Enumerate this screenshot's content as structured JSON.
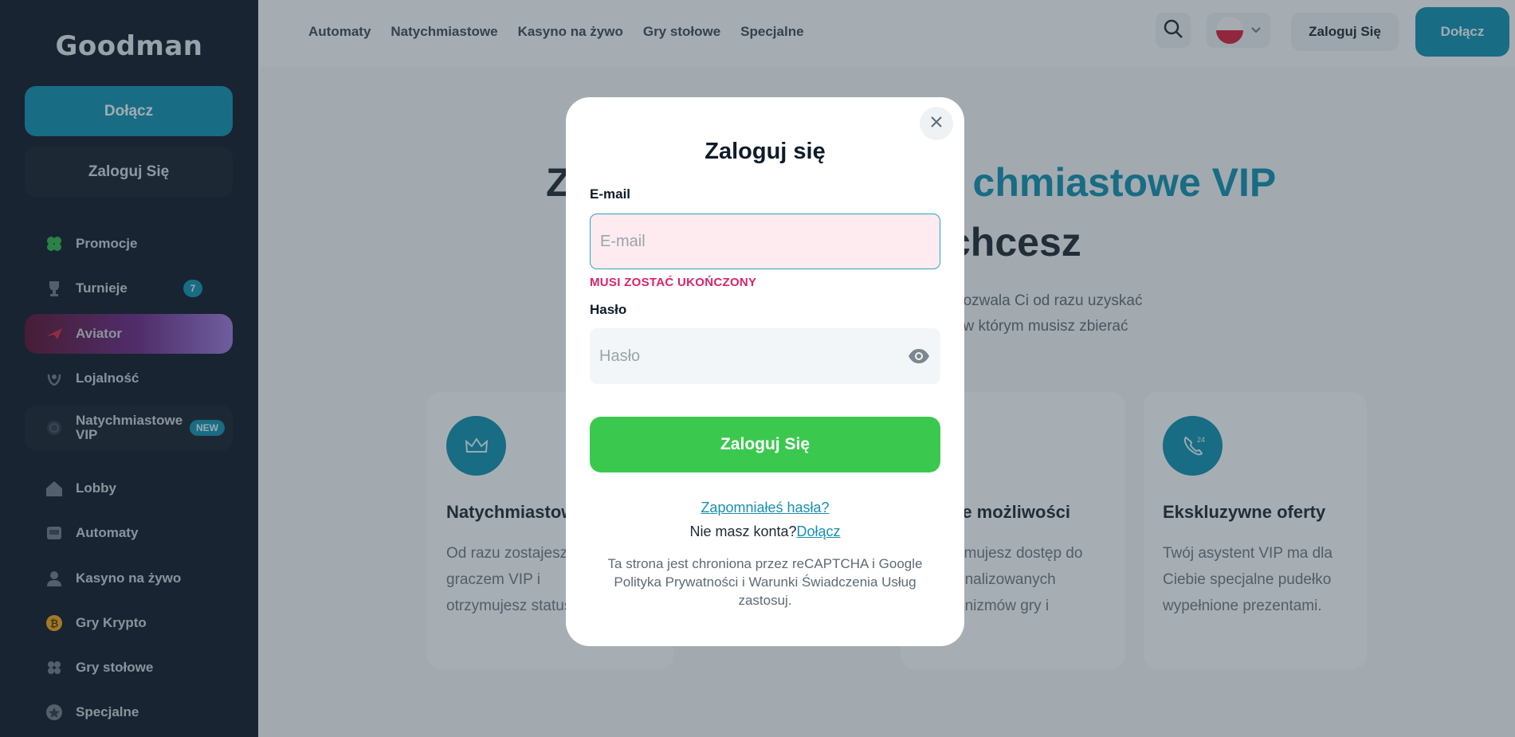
{
  "sidebar": {
    "logo": "Goodman",
    "join_label": "Dołącz",
    "login_label": "Zaloguj Się",
    "items": [
      {
        "label": "Promocje",
        "icon": "clover-icon"
      },
      {
        "label": "Turnieje",
        "icon": "trophy-icon",
        "badge": "7"
      },
      {
        "label": "Aviator",
        "icon": "plane-icon"
      },
      {
        "label": "Lojalność",
        "icon": "laurel-icon"
      },
      {
        "label": "Natychmiastowe VIP",
        "icon": "vip-icon",
        "badge": "NEW"
      },
      {
        "label": "Lobby",
        "icon": "home-icon"
      },
      {
        "label": "Automaty",
        "icon": "slot-machine-icon"
      },
      {
        "label": "Kasyno na żywo",
        "icon": "dealer-icon"
      },
      {
        "label": "Gry Krypto",
        "icon": "bitcoin-icon"
      },
      {
        "label": "Gry stołowe",
        "icon": "cards-icon"
      },
      {
        "label": "Specjalne",
        "icon": "star-icon"
      }
    ]
  },
  "header": {
    "nav": [
      "Automaty",
      "Natychmiastowe",
      "Kasyno na żywo",
      "Gry stołowe",
      "Specjalne"
    ],
    "login_label": "Zaloguj Się",
    "join_label": "Dołącz"
  },
  "hero": {
    "line1_start": "Z",
    "line1_accent": "chmiastowe VIP",
    "line2": "chcesz",
    "desc_line1": "pozwala Ci od razu uzyskać",
    "desc_line2": ", w którym musisz zbierać"
  },
  "cards": [
    {
      "title": "Natychmiastowe",
      "text": "Od razu zostajesz graczem VIP i otrzymujesz status",
      "icon": "crown-icon"
    },
    {
      "title": "te możliwości",
      "text": "ymujesz dostęp do onalizowanych anizmów gry i",
      "icon": "gamepad-icon"
    },
    {
      "title": "Ekskluzywne oferty",
      "text": "Twój asystent VIP ma dla Ciebie specjalne pudełko wypełnione prezentami.",
      "icon": "phone-24-icon"
    }
  ],
  "modal": {
    "title": "Zaloguj się",
    "email_label": "E-mail",
    "email_placeholder": "E-mail",
    "error": "MUSI ZOSTAĆ UKOŃCZONY",
    "password_label": "Hasło",
    "password_placeholder": "Hasło",
    "submit_label": "Zaloguj Się",
    "forgot_label": "Zapomniałeś hasła?",
    "no_account": "Nie masz konta?",
    "join_link": "Dołącz",
    "recaptcha": "Ta strona jest chroniona przez reCAPTCHA i Google Polityka Prywatności i Warunki Świadczenia Usług zastosuj."
  },
  "colors": {
    "accent": "#0f8fae",
    "submit": "#3ac94e",
    "error": "#d6246a",
    "sidebar_bg": "#0f1b2a"
  }
}
